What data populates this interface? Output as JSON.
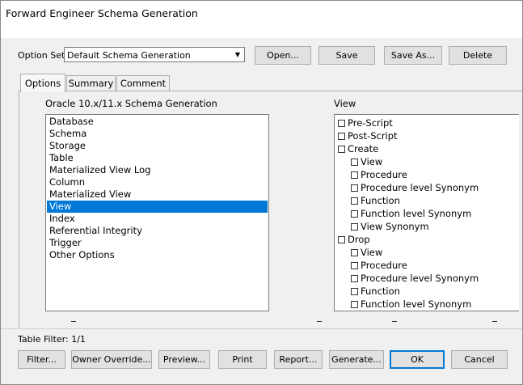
{
  "window": {
    "title": "Forward Engineer Schema Generation"
  },
  "option_set": {
    "label": "Option Set:",
    "value": "Default Schema Generation",
    "buttons": {
      "open": "Open...",
      "save": "Save",
      "save_as": "Save As...",
      "delete": "Delete"
    }
  },
  "tabs": [
    {
      "label": "Options"
    },
    {
      "label": "Summary"
    },
    {
      "label": "Comment"
    }
  ],
  "left_panel": {
    "heading": "Oracle 10.x/11.x Schema Generation",
    "items": [
      "Database",
      "Schema",
      "Storage",
      "Table",
      "Materialized View Log",
      "Column",
      "Materialized View",
      "View",
      "Index",
      "Referential Integrity",
      "Trigger",
      "Other Options"
    ],
    "selected": "View"
  },
  "right_panel": {
    "heading": "View",
    "options": [
      {
        "label": "Pre-Script",
        "level": 0,
        "checked": false
      },
      {
        "label": "Post-Script",
        "level": 0,
        "checked": false
      },
      {
        "label": "Create",
        "level": 0,
        "checked": false
      },
      {
        "label": "View",
        "level": 1,
        "checked": false
      },
      {
        "label": "Procedure",
        "level": 1,
        "checked": false
      },
      {
        "label": "Procedure level Synonym",
        "level": 1,
        "checked": false
      },
      {
        "label": "Function",
        "level": 1,
        "checked": false
      },
      {
        "label": "Function level Synonym",
        "level": 1,
        "checked": false
      },
      {
        "label": "View Synonym",
        "level": 1,
        "checked": false
      },
      {
        "label": "Drop",
        "level": 0,
        "checked": false
      },
      {
        "label": "View",
        "level": 1,
        "checked": false
      },
      {
        "label": "Procedure",
        "level": 1,
        "checked": false
      },
      {
        "label": "Procedure level Synonym",
        "level": 1,
        "checked": false
      },
      {
        "label": "Function",
        "level": 1,
        "checked": false
      },
      {
        "label": "Function level Synonym",
        "level": 1,
        "checked": false
      }
    ]
  },
  "table_filter": "Table Filter: 1/1",
  "bottom_buttons": {
    "filter": "Filter...",
    "owner_override": "Owner Override...",
    "preview": "Preview...",
    "print": "Print",
    "report": "Report...",
    "generate": "Generate...",
    "ok": "OK",
    "cancel": "Cancel"
  }
}
